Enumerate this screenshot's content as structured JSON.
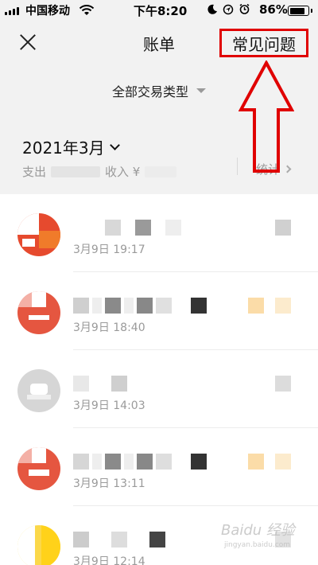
{
  "status_bar": {
    "carrier": "中国移动",
    "time": "下午8:20",
    "battery": "86%",
    "battery_level": 0.86
  },
  "header": {
    "title": "账单",
    "faq_label": "常见问题",
    "filter_label": "全部交易类型"
  },
  "summary": {
    "month": "2021年3月",
    "expense_label": "支出",
    "income_label": "收入 ¥",
    "stats_label": "统计"
  },
  "transactions": [
    {
      "time": "3月9日 19:17",
      "avatar": "orange-red"
    },
    {
      "time": "3月9日 18:40",
      "avatar": "red"
    },
    {
      "time": "3月9日 14:03",
      "avatar": "gray"
    },
    {
      "time": "3月9日 13:11",
      "avatar": "red"
    },
    {
      "time": "3月9日 12:14",
      "avatar": "yellow"
    }
  ],
  "watermark": {
    "brand": "Baidu 经验",
    "url": "jingyan.baidu.com"
  },
  "colors": {
    "background": "#f2f2f2",
    "annotation": "#e00000"
  }
}
